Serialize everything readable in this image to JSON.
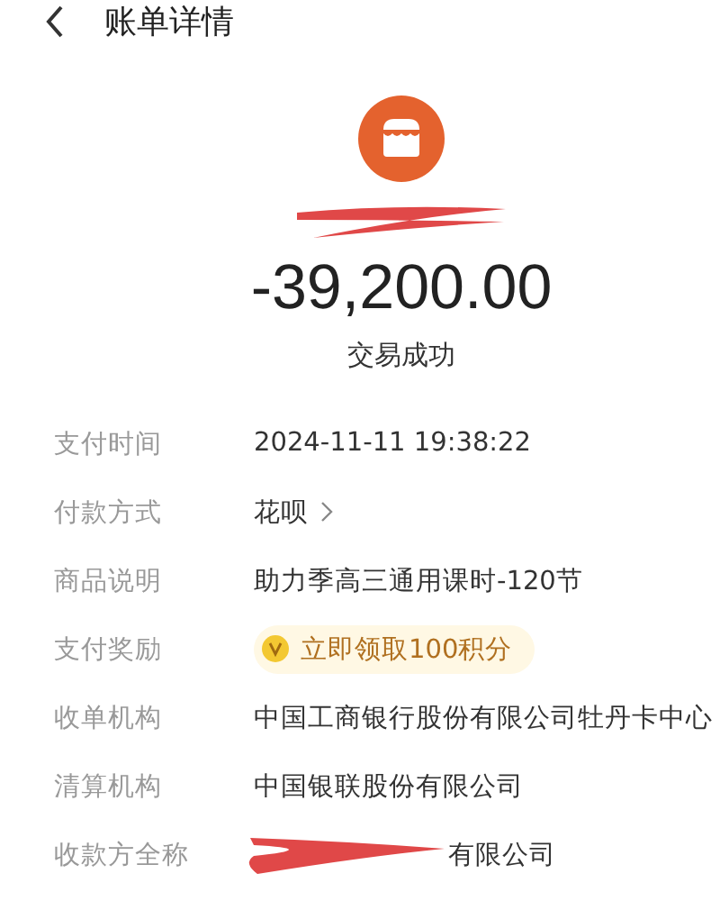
{
  "header": {
    "title": "账单详情"
  },
  "amount": "-39,200.00",
  "status": "交易成功",
  "details": [
    {
      "kind": "text",
      "label": "支付时间",
      "value": "2024-11-11 19:38:22"
    },
    {
      "kind": "link",
      "label": "付款方式",
      "value": "花呗"
    },
    {
      "kind": "text",
      "label": "商品说明",
      "value": "助力季高三通用课时-120节"
    },
    {
      "kind": "reward",
      "label": "支付奖励",
      "value": "立即领取100积分"
    },
    {
      "kind": "text",
      "label": "收单机构",
      "value": "中国工商银行股份有限公司牡丹卡中心"
    },
    {
      "kind": "text",
      "label": "清算机构",
      "value": "中国银联股份有限公司"
    },
    {
      "kind": "redacted",
      "label": "收款方全称",
      "value": "有限公司"
    }
  ]
}
